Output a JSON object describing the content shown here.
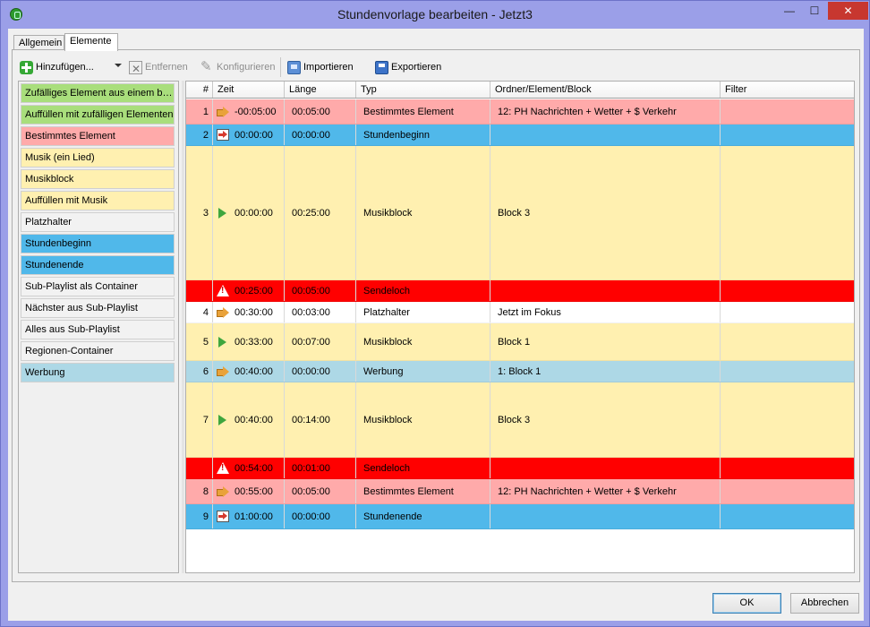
{
  "window": {
    "title": "Stundenvorlage bearbeiten - Jetzt3",
    "min_glyph": "—",
    "max_glyph": "☐",
    "close_glyph": "✕"
  },
  "tabs": [
    {
      "label": "Allgemein"
    },
    {
      "label": "Elemente",
      "active": true
    }
  ],
  "toolbar": {
    "add_label": "Hinzufügen...",
    "remove_label": "Entfernen",
    "configure_label": "Konfigurieren",
    "import_label": "Importieren",
    "export_label": "Exportieren"
  },
  "palette": [
    {
      "label": "Zufälliges Element aus einem bestimmten Ordner",
      "color": "#a9de7c"
    },
    {
      "label": "Auffüllen mit zufälligen Elementen",
      "color": "#a9de7c"
    },
    {
      "label": "Bestimmtes Element",
      "color": "#ffaaaa"
    },
    {
      "label": "Musik (ein Lied)",
      "color": "#fff0b0"
    },
    {
      "label": "Musikblock",
      "color": "#fff0b0"
    },
    {
      "label": "Auffüllen mit Musik",
      "color": "#fff0b0"
    },
    {
      "label": "Platzhalter",
      "color": "#f2f2f2"
    },
    {
      "label": "Stundenbeginn",
      "color": "#50b8ea"
    },
    {
      "label": "Stundenende",
      "color": "#50b8ea"
    },
    {
      "label": "Sub-Playlist als Container",
      "color": "#f2f2f2"
    },
    {
      "label": "Nächster aus Sub-Playlist",
      "color": "#f2f2f2"
    },
    {
      "label": "Alles aus Sub-Playlist",
      "color": "#f2f2f2"
    },
    {
      "label": "Regionen-Container",
      "color": "#f2f2f2"
    },
    {
      "label": "Werbung",
      "color": "#add8e6"
    }
  ],
  "grid": {
    "columns": [
      "#",
      "Zeit",
      "Länge",
      "Typ",
      "Ordner/Element/Block",
      "Filter"
    ],
    "rows": [
      {
        "num": "1",
        "icon": "arrow-orange-icon",
        "time": "-00:05:00",
        "length": "00:05:00",
        "type": "Bestimmtes Element",
        "folder": "12: PH Nachrichten + Wetter + $ Verkehr",
        "filter": "",
        "color": "#ffaaaa",
        "size": "std"
      },
      {
        "num": "2",
        "icon": "hour-start-icon",
        "time": "00:00:00",
        "length": "00:00:00",
        "type": "Stundenbeginn",
        "folder": "",
        "filter": "",
        "color": "#50b8ea",
        "size": "small"
      },
      {
        "num": "3",
        "icon": "music-block-icon",
        "time": "00:00:00",
        "length": "00:25:00",
        "type": "Musikblock",
        "folder": "Block 3",
        "filter": "",
        "color": "#fff0b0",
        "size": "tall"
      },
      {
        "num": "",
        "icon": "warning-icon",
        "time": "00:25:00",
        "length": "00:05:00",
        "type": "Sendeloch",
        "folder": "",
        "filter": "",
        "color": "#ff0000",
        "size": "small"
      },
      {
        "num": "4",
        "icon": "arrow-orange-icon",
        "time": "00:30:00",
        "length": "00:03:00",
        "type": "Platzhalter",
        "folder": "Jetzt im Fokus",
        "filter": "",
        "color": "#ffffff",
        "size": "small"
      },
      {
        "num": "5",
        "icon": "music-block-icon",
        "time": "00:33:00",
        "length": "00:07:00",
        "type": "Musikblock",
        "folder": "Block 1",
        "filter": "",
        "color": "#fff0b0",
        "size": "mid"
      },
      {
        "num": "6",
        "icon": "arrow-orange-icon",
        "time": "00:40:00",
        "length": "00:00:00",
        "type": "Werbung",
        "folder": "1: Block 1",
        "filter": "",
        "color": "#add8e6",
        "size": "small"
      },
      {
        "num": "7",
        "icon": "music-block-icon",
        "time": "00:40:00",
        "length": "00:14:00",
        "type": "Musikblock",
        "folder": "Block 3",
        "filter": "",
        "color": "#fff0b0",
        "size": "big"
      },
      {
        "num": "",
        "icon": "warning-icon",
        "time": "00:54:00",
        "length": "00:01:00",
        "type": "Sendeloch",
        "folder": "",
        "filter": "",
        "color": "#ff0000",
        "size": "small"
      },
      {
        "num": "8",
        "icon": "arrow-orange-icon",
        "time": "00:55:00",
        "length": "00:05:00",
        "type": "Bestimmtes Element",
        "folder": "12: PH Nachrichten + Wetter + $ Verkehr",
        "filter": "",
        "color": "#ffaaaa",
        "size": "std"
      },
      {
        "num": "9",
        "icon": "hour-end-icon",
        "time": "01:00:00",
        "length": "00:00:00",
        "type": "Stundenende",
        "folder": "",
        "filter": "",
        "color": "#50b8ea",
        "size": "std"
      }
    ]
  },
  "buttons": {
    "ok": "OK",
    "cancel": "Abbrechen"
  }
}
